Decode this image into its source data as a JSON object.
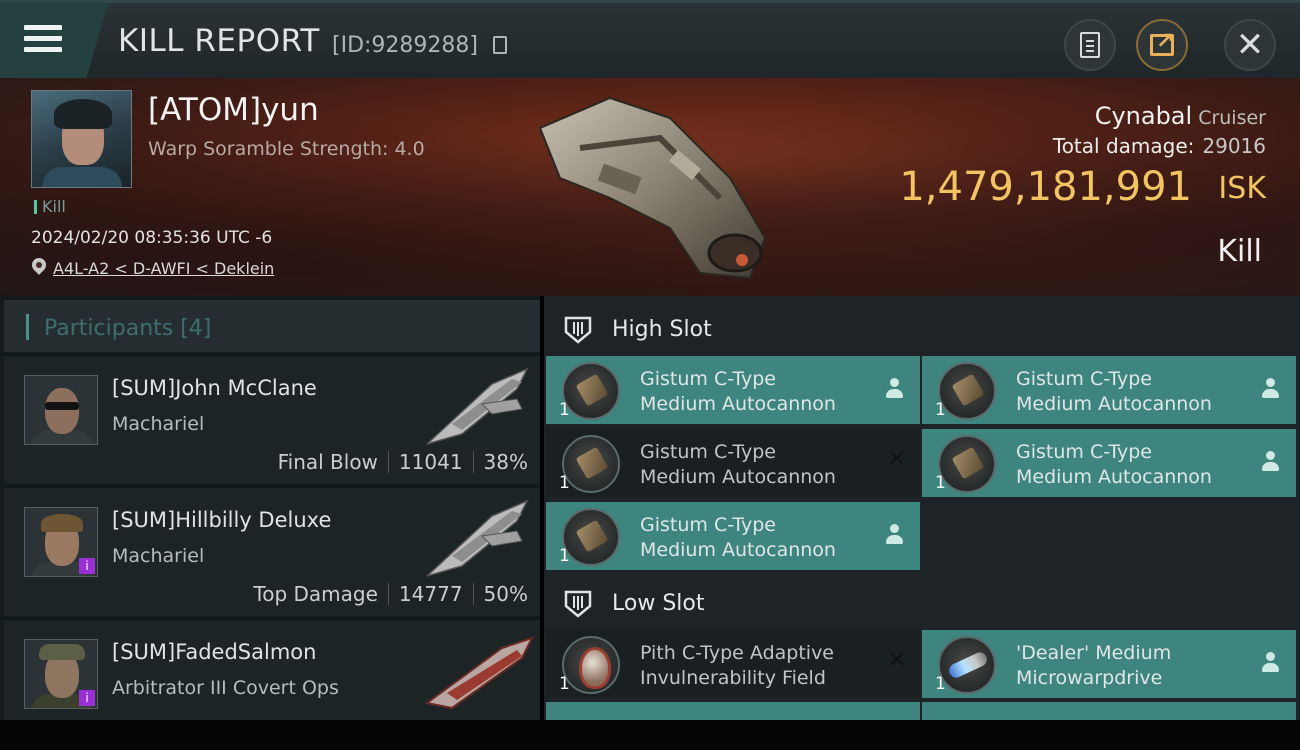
{
  "header": {
    "title": "KILL REPORT",
    "report_id": "[ID:9289288]",
    "menu_icon": "hamburger-menu-icon",
    "buttons": [
      "clipboard-icon",
      "share-icon",
      "close-icon"
    ]
  },
  "victim": {
    "name": "[ATOM]yun",
    "warp": "Warp Soramble Strength: 4.0",
    "tag": "Kill",
    "timestamp": "2024/02/20 08:35:36 UTC -6",
    "location": "A4L-A2 < D-AWFI < Deklein",
    "ship": "Cynabal",
    "ship_class": "Cruiser",
    "total_damage_label": "Total damage:",
    "total_damage": "29016",
    "isk_value": "1,479,181,991",
    "isk_unit": "ISK",
    "result": "Kill"
  },
  "participants": {
    "header": "Participants [4]",
    "items": [
      {
        "name": "[SUM]John McClane",
        "ship": "Machariel",
        "role": "Final Blow",
        "damage": "11041",
        "percent": "38%"
      },
      {
        "name": "[SUM]Hillbilly Deluxe",
        "ship": "Machariel",
        "role": "Top Damage",
        "damage": "14777",
        "percent": "50%"
      },
      {
        "name": "[SUM]FadedSalmon",
        "ship": "Arbitrator III Covert Ops",
        "role": "",
        "damage": "",
        "percent": ""
      }
    ]
  },
  "fitting": {
    "high_slot": {
      "title": "High Slot",
      "modules": [
        {
          "line1": "Gistum C-Type",
          "line2": "Medium Autocannon",
          "qty": "1",
          "status": "dropped"
        },
        {
          "line1": "Gistum C-Type",
          "line2": "Medium Autocannon",
          "qty": "1",
          "status": "dropped"
        },
        {
          "line1": "Gistum C-Type",
          "line2": "Medium Autocannon",
          "qty": "1",
          "status": "destroyed"
        },
        {
          "line1": "Gistum C-Type",
          "line2": "Medium Autocannon",
          "qty": "1",
          "status": "dropped"
        },
        {
          "line1": "Gistum C-Type",
          "line2": "Medium Autocannon",
          "qty": "1",
          "status": "dropped"
        }
      ]
    },
    "low_slot": {
      "title": "Low Slot",
      "modules": [
        {
          "line1": "Pith C-Type Adaptive",
          "line2": "Invulnerability Field",
          "qty": "1",
          "status": "destroyed"
        },
        {
          "line1": "'Dealer' Medium",
          "line2": "Microwarpdrive",
          "qty": "1",
          "status": "dropped"
        }
      ]
    }
  },
  "colors": {
    "accent": "#3d857e",
    "isk": "#f2c462",
    "banner": "#5c2417"
  }
}
